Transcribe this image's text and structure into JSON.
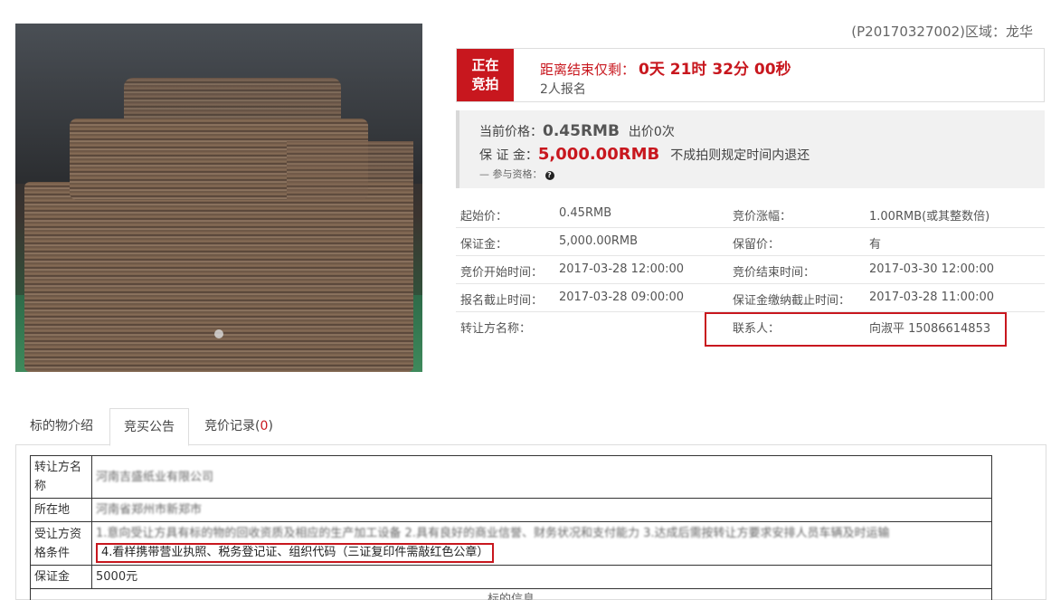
{
  "region": "(P20170327002)区域：龙华",
  "status": {
    "badge": "正在竞拍",
    "countdown_label": "距离结束仅剩：",
    "countdown_value": "0天 21时 32分 00秒",
    "signup": "2人报名"
  },
  "price": {
    "current_label": "当前价格：",
    "current_value": "0.45RMB",
    "bids": "出价0次",
    "deposit_label": "保 证 金：",
    "deposit_value": "5,000.00RMB",
    "deposit_note": "不成拍则规定时间内退还",
    "qualification": "— 参与资格："
  },
  "info": {
    "rows": [
      {
        "k1": "起始价：",
        "v1": "0.45RMB",
        "k2": "竞价涨幅：",
        "v2": "1.00RMB(或其整数倍)"
      },
      {
        "k1": "保证金：",
        "v1": "5,000.00RMB",
        "k2": "保留价：",
        "v2": "有"
      },
      {
        "k1": "竞价开始时间：",
        "v1": "2017-03-28 12:00:00",
        "k2": "竞价结束时间：",
        "v2": "2017-03-30 12:00:00"
      },
      {
        "k1": "报名截止时间：",
        "v1": "2017-03-28 09:00:00",
        "k2": "保证金缴纳截止时间：",
        "v2": "2017-03-28 11:00:00"
      },
      {
        "k1": "转让方名称：",
        "v1": "",
        "k2": "联系人：",
        "v2": "向淑平 15086614853"
      }
    ]
  },
  "tabs": [
    {
      "label": "标的物介绍"
    },
    {
      "label": "竞买公告"
    },
    {
      "label": "竞价记录(",
      "count": "0",
      "suffix": ")"
    }
  ],
  "announcement": {
    "r1_label": "转让方名称",
    "r1_value": "河南吉盛纸业有限公司",
    "r2_label": "所在地",
    "r2_value": "河南省郑州市新郑市",
    "r3_label": "受让方资格条件",
    "r3_value": "1.意向受让方具有标的物的回收资质及相应的生产加工设备 2.具有良好的商业信誉、财务状况和支付能力 3.达成后需按转让方要求安排人员车辆及时运输",
    "r3_highlight": "4.看样携带营业执照、税务登记证、组织代码（三证复印件需敲红色公章）",
    "r4_label": "保证金",
    "r4_value": "5000元",
    "r5_value": "标的信息"
  }
}
